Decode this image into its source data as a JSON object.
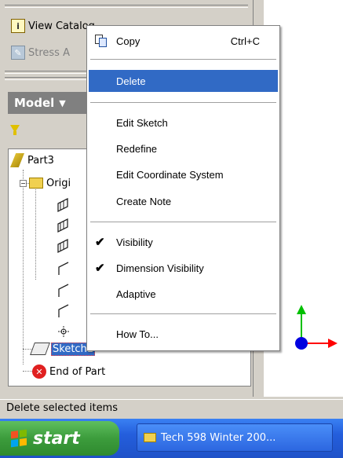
{
  "toolbar": {
    "view_catalog": "View Catalog",
    "stress_analysis": "Stress A"
  },
  "browser": {
    "model_label": "Model",
    "tree": {
      "root": "Part3",
      "origin": "Origi",
      "sketch": "Sketch1",
      "end": "End of Part"
    }
  },
  "context_menu": {
    "items": [
      {
        "label": "Copy",
        "shortcut": "Ctrl+C",
        "icon": "copy-icon"
      },
      {
        "label": "Delete",
        "highlighted": true
      },
      {
        "label": "Edit Sketch"
      },
      {
        "label": "Redefine"
      },
      {
        "label": "Edit Coordinate System"
      },
      {
        "label": "Create Note"
      },
      {
        "label": "Visibility",
        "checked": true
      },
      {
        "label": "Dimension Visibility",
        "checked": true
      },
      {
        "label": "Adaptive"
      },
      {
        "label": "How To..."
      }
    ]
  },
  "status_bar": {
    "text": "Delete selected items"
  },
  "taskbar": {
    "start": "start",
    "task_item": "Tech 598 Winter 200..."
  },
  "colors": {
    "menu_highlight": "#316ac5",
    "taskbar": "#245edc",
    "start_button": "#3c9c3c",
    "axis_x": "#ff0000",
    "axis_y": "#00c000",
    "axis_origin": "#0000e0"
  }
}
